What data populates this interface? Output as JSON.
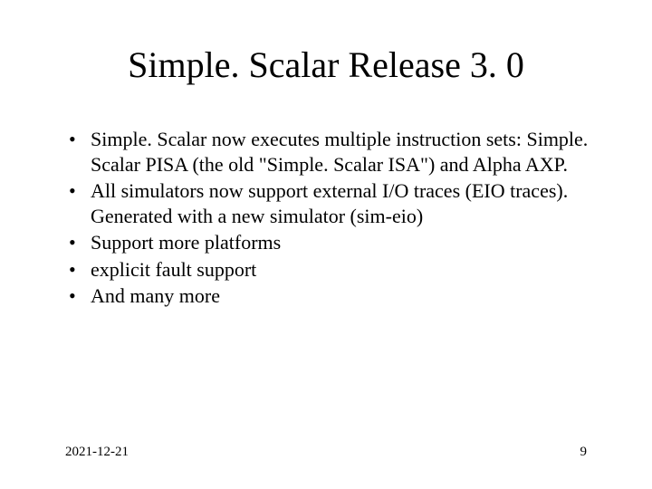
{
  "title": "Simple. Scalar Release 3. 0",
  "bullets": [
    "Simple. Scalar now executes multiple instruction sets: Simple. Scalar PISA (the old \"Simple. Scalar ISA\") and Alpha AXP.",
    "All simulators now support external I/O traces (EIO traces). Generated with a new simulator (sim-eio)",
    "Support more platforms",
    "explicit fault support",
    "And many more"
  ],
  "footer": {
    "date": "2021-12-21",
    "page": "9"
  }
}
